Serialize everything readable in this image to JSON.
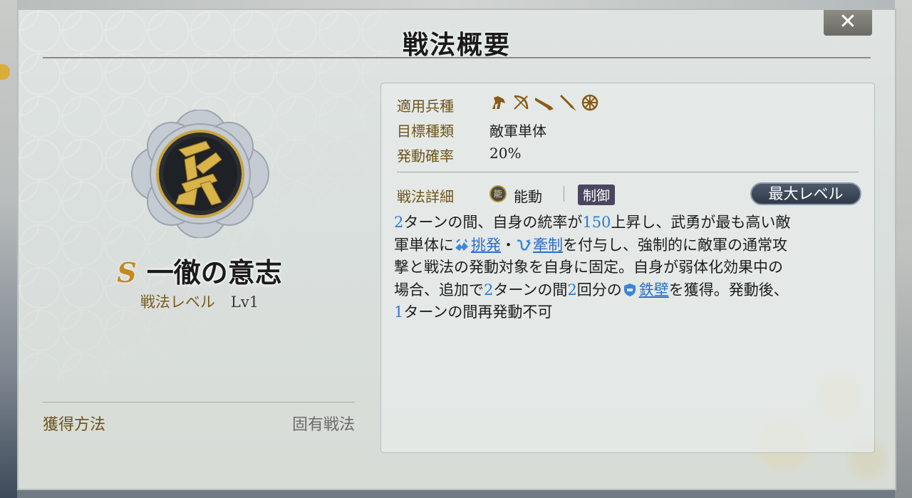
{
  "dialog": {
    "title": "戦法概要",
    "close_label": "✕"
  },
  "skill": {
    "grade": "S",
    "name": "一徹の意志",
    "level_label": "戦法レベル",
    "level_value": "Lv1",
    "acquisition_label": "獲得方法",
    "acquisition_value": "固有戦法"
  },
  "info": {
    "applicable_units_label": "適用兵種",
    "applicable_units_icons": [
      "cavalry-icon",
      "archer-icon",
      "gun-icon",
      "spear-icon",
      "siege-wheel-icon"
    ],
    "target_type_label": "目標種類",
    "target_type_value": "敵軍単体",
    "activation_rate_label": "発動確率",
    "activation_rate_value": "20%"
  },
  "details": {
    "label": "戦法詳細",
    "type_mark": "能",
    "type_label": "能動",
    "category_tag": "制御",
    "max_level_button": "最大レベル",
    "line1_n1": "2",
    "line1_a": "ターンの間、自身の統率が",
    "line1_n2": "150",
    "line1_b": "上昇し、武勇が最も高い敵",
    "line2_a": "軍単体に",
    "line2_link1": "挑発",
    "line2_sep": "・",
    "line2_link2": "牽制",
    "line2_b": "を付与し、強制的に敵軍の通常攻",
    "line3": "撃と戦法の発動対象を自身に固定。自身が弱体化効果中の",
    "line4_a": "場合、追加で",
    "line4_n1": "2",
    "line4_b": "ターンの間",
    "line4_n2": "2",
    "line4_c": "回分の",
    "line4_link": "鉄壁",
    "line4_d": "を獲得。発動後、",
    "line5_n": "1",
    "line5_a": "ターンの間再発動不可"
  },
  "colors": {
    "label_gold": "#6e5318",
    "number_blue": "#2b7bd6",
    "grade_gold": "#c38a1c"
  }
}
